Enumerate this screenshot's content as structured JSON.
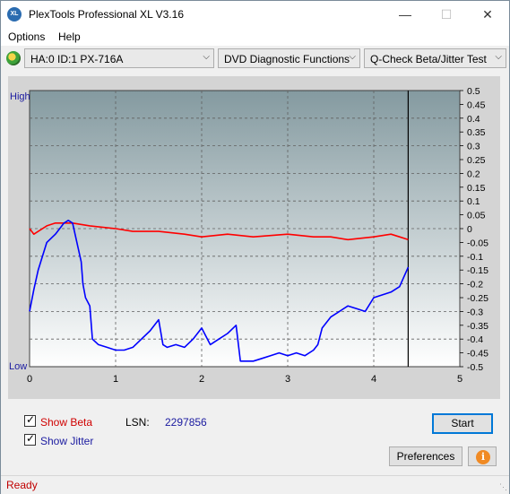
{
  "window": {
    "title": "PlexTools Professional XL V3.16",
    "app_icon_text": "XL",
    "minimize_glyph": "—",
    "maximize_glyph": "☐",
    "close_glyph": "✕"
  },
  "menu": [
    {
      "label": "Options"
    },
    {
      "label": "Help"
    }
  ],
  "toolbar": {
    "drive": "HA:0 ID:1  PX-716A",
    "function": "DVD Diagnostic Functions",
    "test": "Q-Check Beta/Jitter Test"
  },
  "chart_data": {
    "type": "line",
    "left_axis": {
      "top_label": "High",
      "bottom_label": "Low"
    },
    "x_ticks": [
      "0",
      "1",
      "2",
      "3",
      "4",
      "5"
    ],
    "xlim": [
      0,
      5
    ],
    "right_ticks": [
      "0.5",
      "0.45",
      "0.4",
      "0.35",
      "0.3",
      "0.25",
      "0.2",
      "0.15",
      "0.1",
      "0.05",
      "0",
      "-0.05",
      "-0.1",
      "-0.15",
      "-0.2",
      "-0.25",
      "-0.3",
      "-0.35",
      "-0.4",
      "-0.45",
      "-0.5"
    ],
    "ylim": [
      -0.5,
      0.5
    ],
    "end_marker_x": 4.4,
    "series": [
      {
        "name": "Beta",
        "color": "#ff0000",
        "x": [
          0,
          0.05,
          0.1,
          0.2,
          0.3,
          0.4,
          0.5,
          0.7,
          1.0,
          1.2,
          1.5,
          1.8,
          2.0,
          2.3,
          2.6,
          3.0,
          3.3,
          3.5,
          3.7,
          4.0,
          4.2,
          4.3,
          4.4
        ],
        "values": [
          0.0,
          -0.02,
          -0.01,
          0.01,
          0.02,
          0.02,
          0.02,
          0.01,
          0.0,
          -0.01,
          -0.01,
          -0.02,
          -0.03,
          -0.02,
          -0.03,
          -0.02,
          -0.03,
          -0.03,
          -0.04,
          -0.03,
          -0.02,
          -0.03,
          -0.04
        ]
      },
      {
        "name": "Jitter",
        "color": "#0000ff",
        "x": [
          0,
          0.05,
          0.1,
          0.15,
          0.2,
          0.3,
          0.4,
          0.45,
          0.5,
          0.55,
          0.6,
          0.62,
          0.65,
          0.7,
          0.73,
          0.8,
          0.9,
          1.0,
          1.1,
          1.2,
          1.3,
          1.4,
          1.5,
          1.55,
          1.6,
          1.7,
          1.8,
          1.9,
          2.0,
          2.1,
          2.2,
          2.3,
          2.4,
          2.45,
          2.5,
          2.6,
          2.7,
          2.8,
          2.9,
          3.0,
          3.1,
          3.2,
          3.3,
          3.35,
          3.4,
          3.5,
          3.6,
          3.7,
          3.8,
          3.9,
          4.0,
          4.1,
          4.2,
          4.3,
          4.4
        ],
        "values": [
          -0.3,
          -0.22,
          -0.15,
          -0.1,
          -0.05,
          -0.02,
          0.02,
          0.03,
          0.02,
          -0.05,
          -0.12,
          -0.2,
          -0.25,
          -0.28,
          -0.4,
          -0.42,
          -0.43,
          -0.44,
          -0.44,
          -0.43,
          -0.4,
          -0.37,
          -0.33,
          -0.42,
          -0.43,
          -0.42,
          -0.43,
          -0.4,
          -0.36,
          -0.42,
          -0.4,
          -0.38,
          -0.35,
          -0.48,
          -0.48,
          -0.48,
          -0.47,
          -0.46,
          -0.45,
          -0.46,
          -0.45,
          -0.46,
          -0.44,
          -0.42,
          -0.36,
          -0.32,
          -0.3,
          -0.28,
          -0.29,
          -0.3,
          -0.25,
          -0.24,
          -0.23,
          -0.21,
          -0.14
        ]
      }
    ],
    "colors": {
      "plot_top": "#849aa0",
      "plot_bottom": "#ffffff",
      "grid": "#606060",
      "axis_label": "#1a1aa0"
    }
  },
  "controls": {
    "show_beta_label": "Show Beta",
    "show_jitter_label": "Show Jitter",
    "show_beta_checked": true,
    "show_jitter_checked": true,
    "lsn_label": "LSN:",
    "lsn_value": "2297856",
    "start_label": "Start",
    "preferences_label": "Preferences",
    "info_icon_glyph": "i"
  },
  "status": {
    "text": "Ready",
    "color": "#c00000"
  }
}
